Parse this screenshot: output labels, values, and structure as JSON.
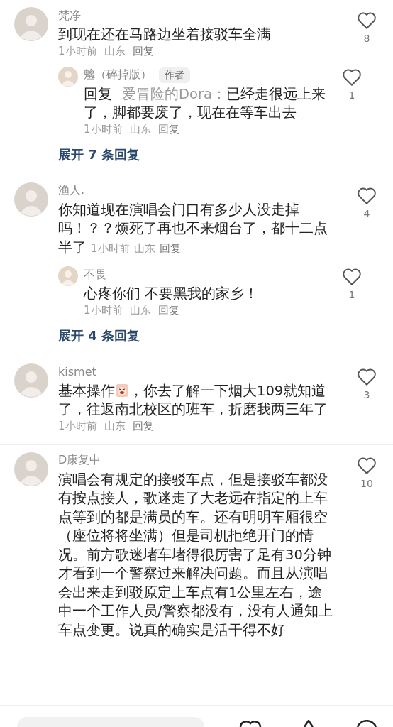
{
  "comments": [
    {
      "name": "梵净",
      "text": "到现在还在马路边坐着接驳车全满",
      "meta": [
        "1小时前",
        "山东",
        "回复"
      ],
      "likes": "8",
      "inline_meta": false,
      "replies": [
        {
          "name": "魑（碎掉版）",
          "badge": "作者",
          "reply_label": "回复",
          "reply_to": "爱冒险的Dora：",
          "text": "已经走很远上来了，脚都要废了，现在在等车出去",
          "meta": [
            "1小时前",
            "山东",
            "回复"
          ],
          "likes": "1"
        }
      ],
      "expand": "展开 7 条回复"
    },
    {
      "name": "渔人.",
      "text": "你知道现在演唱会门口有多少人没走掉吗！？？烦死了再也不来烟台了，都十二点半了",
      "meta": [
        "1小时前",
        "山东",
        "回复"
      ],
      "likes": "4",
      "inline_meta": true,
      "replies": [
        {
          "name": "不畏",
          "text": "心疼你们 不要黑我的家乡！",
          "meta": [
            "1小时前",
            "山东",
            "回复"
          ],
          "likes": "1"
        }
      ],
      "expand": "展开 4 条回复"
    },
    {
      "name": "kismet",
      "text": "基本操作",
      "sticker": true,
      "text_after": "，你去了解一下烟大109就知道了，往返南北校区的班车，折磨我两三年了",
      "meta": [
        "1小时前",
        "山东",
        "回复"
      ],
      "likes": "3",
      "inline_meta": false
    },
    {
      "name": "D康复中",
      "text": "演唱会有规定的接驳车点，但是接驳车都没有按点接人，歌迷走了大老远在指定的上车点等到的都是满员的车。还有明明车厢很空（座位将将坐满）但是司机拒绝开门的情况。前方歌迷堵车堵得很厉害了足有30分钟才看到一个警察过来解决问题。而且从演唱会出来走到驳原定上车点有1公里左右，途中一个工作人员/警察都没有，没有人通知上车点变更。说真的确实是活干得不好",
      "likes": "10",
      "inline_meta": false
    }
  ],
  "bottom_bar": {
    "kind": "input"
  }
}
